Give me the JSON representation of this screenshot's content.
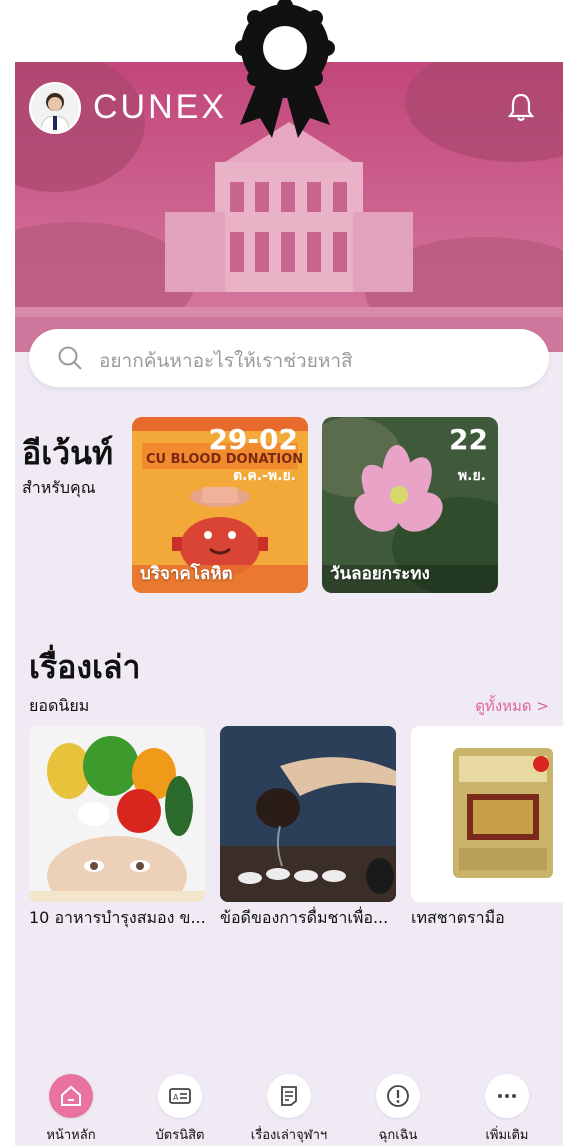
{
  "header": {
    "brand": "CUNEX"
  },
  "search": {
    "placeholder": "อยากค้นหาอะไรให้เราช่วยหาสิ"
  },
  "events": {
    "title": "อีเว้นท์",
    "subtitle": "สำหรับคุณ",
    "cards": [
      {
        "date": "29-02",
        "month": "ต.ค.-พ.ย.",
        "label": "บริจาคโลหิต",
        "banner": "CU BLOOD DONATION"
      },
      {
        "date": "22",
        "month": "พ.ย.",
        "label": "วันลอยกระทง"
      }
    ]
  },
  "stories": {
    "title": "เรื่องเล่า",
    "subtitle": "ยอดนิยม",
    "see_all": "ดูทั้งหมด >",
    "items": [
      {
        "caption": "10 อาหารบำรุงสมอง ข..."
      },
      {
        "caption": "ข้อดีของการดื่มชาเพื่อ..."
      },
      {
        "caption": "เทสชาตรามือ"
      }
    ]
  },
  "nav": {
    "items": [
      {
        "label": "หน้าหลัก",
        "icon": "home-icon",
        "active": true
      },
      {
        "label": "บัตรนิสิต",
        "icon": "id-card-icon",
        "active": false
      },
      {
        "label": "เรื่องเล่าจุฬาฯ",
        "icon": "document-icon",
        "active": false
      },
      {
        "label": "ฉุกเฉิน",
        "icon": "alert-icon",
        "active": false
      },
      {
        "label": "เพิ่มเติม",
        "icon": "more-icon",
        "active": false
      }
    ]
  },
  "colors": {
    "accent": "#e8739e",
    "hero_tint": "#c9477e",
    "link": "#e0649a",
    "background": "#efeaf3"
  }
}
